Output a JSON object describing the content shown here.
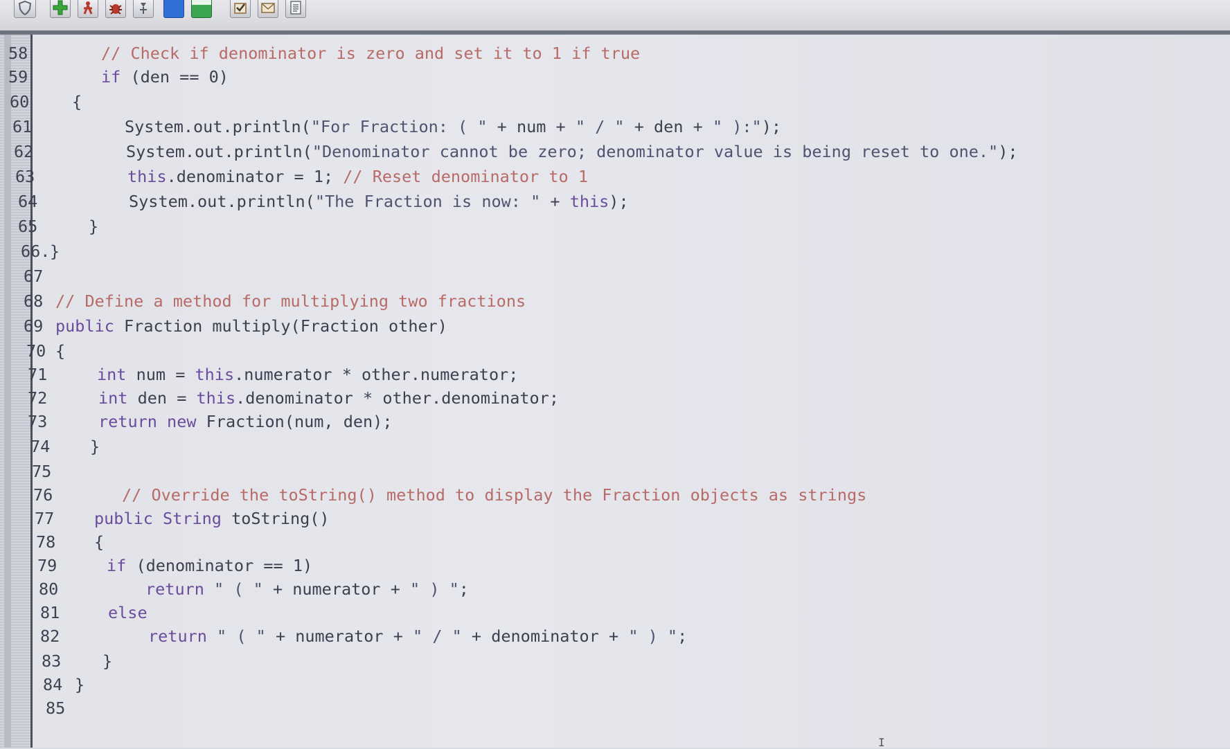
{
  "toolbar": {
    "buttons": [
      {
        "name": "shield-icon",
        "color": "#5c6275"
      },
      {
        "name": "add-icon",
        "color": "#3aa63a"
      },
      {
        "name": "run-icon",
        "color": "#b83a2a"
      },
      {
        "name": "debug-bug-icon",
        "color": "#b83a2a"
      },
      {
        "name": "step-icon",
        "color": "#555b6a"
      },
      {
        "name": "blue-square-icon",
        "color": "#2f6fd6"
      },
      {
        "name": "green-square-icon",
        "color": "#3aa650"
      },
      {
        "name": "check-task-icon",
        "color": "#8a6a3a"
      },
      {
        "name": "mail-icon",
        "color": "#8a6a3a"
      },
      {
        "name": "document-icon",
        "color": "#6a6e7a"
      }
    ]
  },
  "editor": {
    "lines": [
      {
        "n": "58",
        "code": "// Check if denominator is zero and set it to 1 if true"
      },
      {
        "n": "59",
        "code": "if (den == 0)"
      },
      {
        "n": "60",
        "code": "{"
      },
      {
        "n": "61",
        "code": "System.out.println(\"For Fraction: ( \" + num + \" / \" + den + \" ):\");"
      },
      {
        "n": "62",
        "code": "System.out.println(\"Denominator cannot be zero; denominator value is being reset to one.\");"
      },
      {
        "n": "63",
        "code": "this.denominator = 1; // Reset denominator to 1"
      },
      {
        "n": "64",
        "code": "System.out.println(\"The Fraction is now: \" + this);"
      },
      {
        "n": "65",
        "code": "}"
      },
      {
        "n": "66.",
        "code": "}"
      },
      {
        "n": "67",
        "code": ""
      },
      {
        "n": "68",
        "code": "// Define a method for multiplying two fractions"
      },
      {
        "n": "69",
        "code": "public Fraction multiply(Fraction other)"
      },
      {
        "n": "70",
        "code": "{"
      },
      {
        "n": "71",
        "code": "int num = this.numerator * other.numerator;"
      },
      {
        "n": "72",
        "code": "int den = this.denominator * other.denominator;"
      },
      {
        "n": "73",
        "code": "return new Fraction(num, den);"
      },
      {
        "n": "74",
        "code": "}"
      },
      {
        "n": "75",
        "code": ""
      },
      {
        "n": "76",
        "code": "// Override the toString() method to display the Fraction objects as strings"
      },
      {
        "n": "77",
        "code": "public String toString()"
      },
      {
        "n": "78",
        "code": "{"
      },
      {
        "n": "79",
        "code": "if (denominator == 1)"
      },
      {
        "n": "80",
        "code": "return \" ( \" + numerator + \" ) \";"
      },
      {
        "n": "81",
        "code": "else"
      },
      {
        "n": "82",
        "code": "return \" ( \" + numerator + \" / \" + denominator + \" ) \";"
      },
      {
        "n": "83",
        "code": "}"
      },
      {
        "n": "84",
        "code": "}"
      },
      {
        "n": "85",
        "code": ""
      }
    ]
  }
}
